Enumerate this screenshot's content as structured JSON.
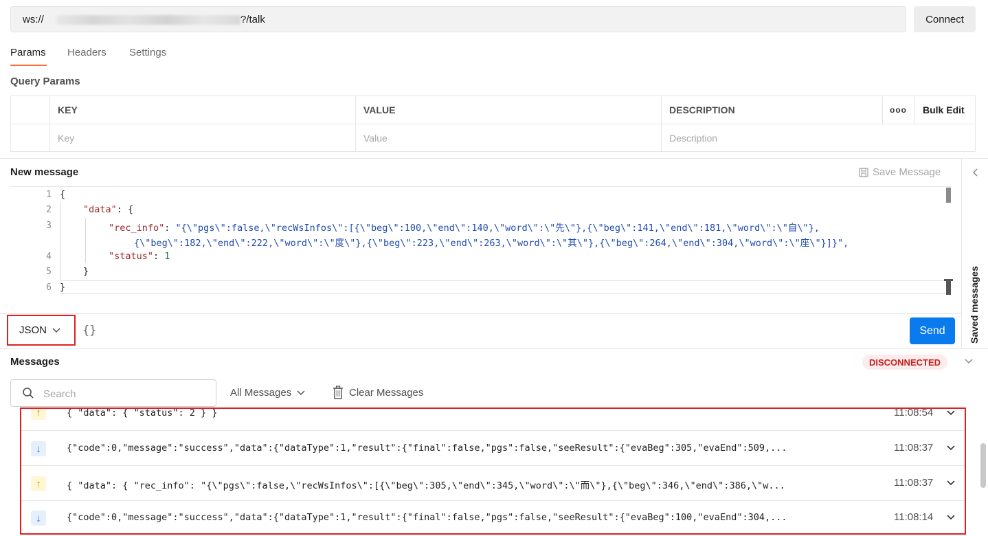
{
  "url_bar": {
    "scheme": "ws://",
    "path": "?/talk",
    "connect_label": "Connect"
  },
  "tabs": [
    {
      "label": "Params",
      "active": true
    },
    {
      "label": "Headers",
      "active": false
    },
    {
      "label": "Settings",
      "active": false
    }
  ],
  "params": {
    "title": "Query Params",
    "headers": {
      "key": "KEY",
      "value": "VALUE",
      "description": "DESCRIPTION",
      "bulk_edit": "Bulk Edit",
      "more_icon": "ooo"
    },
    "placeholders": {
      "key": "Key",
      "value": "Value",
      "description": "Description"
    }
  },
  "new_message": {
    "title": "New message",
    "save_label": "Save Message",
    "line_numbers": [
      "1",
      "2",
      "3",
      "",
      "4",
      "5",
      "6"
    ],
    "code": {
      "l1": "{",
      "l2_key": "\"data\"",
      "l2_rest": ": {",
      "l3_key": "\"rec_info\"",
      "l3_sep": ": ",
      "l3_val": "\"{\\\"pgs\\\":false,\\\"recWsInfos\\\":[{\\\"beg\\\":100,\\\"end\\\":140,\\\"word\\\":\\\"先\\\"},{\\\"beg\\\":141,\\\"end\\\":181,\\\"word\\\":\\\"自\\\"},",
      "l3b_val": "{\\\"beg\\\":182,\\\"end\\\":222,\\\"word\\\":\\\"度\\\"},{\\\"beg\\\":223,\\\"end\\\":263,\\\"word\\\":\\\"其\\\"},{\\\"beg\\\":264,\\\"end\\\":304,\\\"word\\\":\\\"座\\\"}]}\",",
      "l4_key": "\"status\"",
      "l4_sep": ": ",
      "l4_val": "1",
      "l5": "}",
      "l6": "}"
    }
  },
  "format_bar": {
    "format": "JSON",
    "beautify_icon": "{}",
    "send_label": "Send"
  },
  "saved_messages_label": "Saved messages",
  "messages": {
    "title": "Messages",
    "status": "DISCONNECTED",
    "status_color": "#c42020",
    "search_placeholder": "Search",
    "filter_label": "All Messages",
    "clear_label": "Clear Messages",
    "items": [
      {
        "direction": "sent",
        "icon": "arrow-up-icon",
        "text": "{ \"data\": { \"status\": 2 } }",
        "time": "11:08:54"
      },
      {
        "direction": "received",
        "icon": "arrow-down-icon",
        "text": "{\"code\":0,\"message\":\"success\",\"data\":{\"dataType\":1,\"result\":{\"final\":false,\"pgs\":false,\"seeResult\":{\"evaBeg\":305,\"evaEnd\":509,...",
        "time": "11:08:37"
      },
      {
        "direction": "sent",
        "icon": "arrow-up-icon",
        "text": "{ \"data\": { \"rec_info\": \"{\\\"pgs\\\":false,\\\"recWsInfos\\\":[{\\\"beg\\\":305,\\\"end\\\":345,\\\"word\\\":\\\"而\\\"},{\\\"beg\\\":346,\\\"end\\\":386,\\\"w...",
        "time": "11:08:37"
      },
      {
        "direction": "received",
        "icon": "arrow-down-icon",
        "text": "{\"code\":0,\"message\":\"success\",\"data\":{\"dataType\":1,\"result\":{\"final\":false,\"pgs\":false,\"seeResult\":{\"evaBeg\":100,\"evaEnd\":304,...",
        "time": "11:08:14"
      }
    ]
  },
  "colors": {
    "accent_tab": "#ff6c37",
    "send_button": "#097bed",
    "highlight_border": "#e02020"
  }
}
